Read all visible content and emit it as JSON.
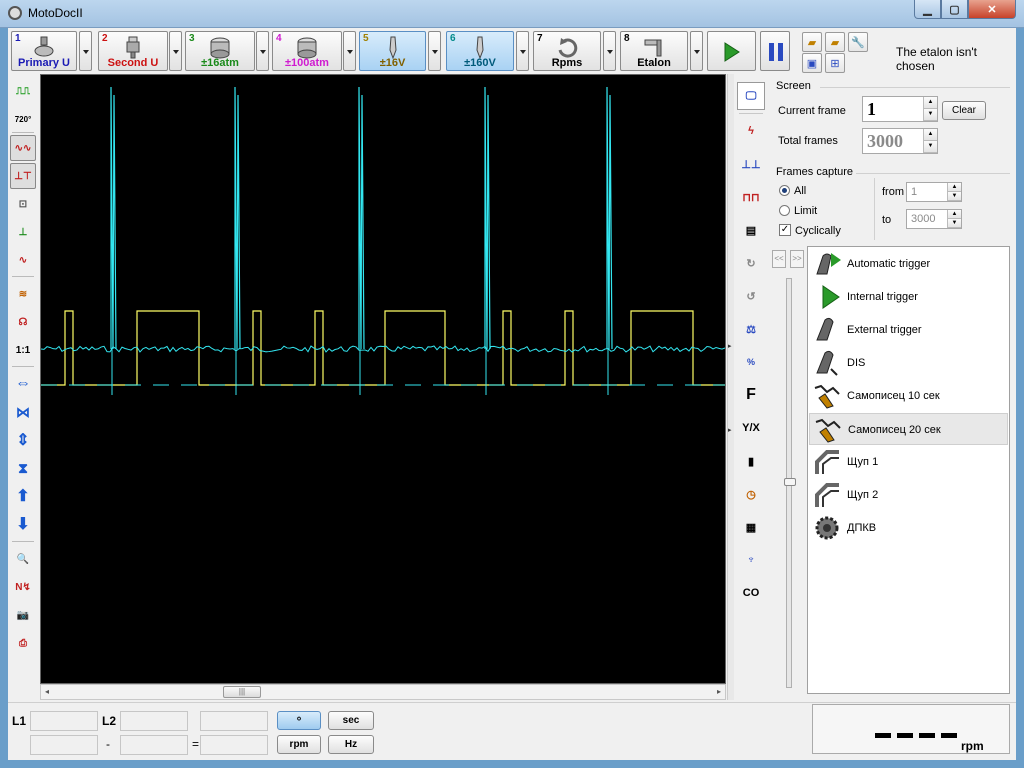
{
  "window": {
    "title": "MotoDocII"
  },
  "toolbar": {
    "channels": [
      {
        "num": "1",
        "label": "Primary U",
        "num_color": "#1a1ab4",
        "label_color": "#1a1ab4",
        "selected": false
      },
      {
        "num": "2",
        "label": "Second U",
        "num_color": "#cc1111",
        "label_color": "#cc1111",
        "selected": false
      },
      {
        "num": "3",
        "label": "±16atm",
        "num_color": "#1a8a1a",
        "label_color": "#1a8a1a",
        "selected": false
      },
      {
        "num": "4",
        "label": "±100atm",
        "num_color": "#d01ad0",
        "label_color": "#d01ad0",
        "selected": false
      },
      {
        "num": "5",
        "label": "±16V",
        "num_color": "#c8a000",
        "label_color": "#806000",
        "selected": true
      },
      {
        "num": "6",
        "label": "±160V",
        "num_color": "#008a8a",
        "label_color": "#005a7a",
        "selected": true
      },
      {
        "num": "7",
        "label": "Rpms",
        "num_color": "#222222",
        "label_color": "#222222",
        "selected": false
      },
      {
        "num": "8",
        "label": "Etalon",
        "num_color": "#222222",
        "label_color": "#222222",
        "selected": false
      }
    ],
    "status": "The etalon isn't chosen"
  },
  "screen": {
    "group_label": "Screen",
    "current_frame_label": "Current frame",
    "current_frame": "1",
    "clear_label": "Clear",
    "total_frames_label": "Total frames",
    "total_frames": "3000"
  },
  "capture": {
    "group_label": "Frames capture",
    "all_label": "All",
    "limit_label": "Limit",
    "cyclically_label": "Cyclically",
    "from_label": "from",
    "from_value": "1",
    "to_label": "to",
    "to_value": "3000"
  },
  "triggers": [
    {
      "label": "Automatic trigger",
      "icon": "automatic-trigger-icon"
    },
    {
      "label": "Internal trigger",
      "icon": "internal-trigger-icon"
    },
    {
      "label": "External trigger",
      "icon": "external-trigger-icon"
    },
    {
      "label": "DIS",
      "icon": "dis-icon"
    },
    {
      "label": "Самописец 10 сек",
      "icon": "recorder-10-icon"
    },
    {
      "label": "Самописец 20 сек",
      "icon": "recorder-20-icon",
      "selected": true
    },
    {
      "label": "Щуп 1",
      "icon": "probe-1-icon"
    },
    {
      "label": "Щуп 2",
      "icon": "probe-2-icon"
    },
    {
      "label": "ДПКВ",
      "icon": "crank-sensor-icon"
    }
  ],
  "left_toolbar": {
    "ratio_label": "1:1",
    "angle_label": "720°"
  },
  "right_icons": {
    "f_label": "F",
    "yx_label": "Y/X",
    "co_label": "CO",
    "percent_label": "%"
  },
  "bottom": {
    "l1_label": "L1",
    "l2_label": "L2",
    "dash_sep": "-",
    "equals_sep": "=",
    "degree_label": "°",
    "sec_label": "sec",
    "rpm_label": "rpm",
    "hz_label": "Hz",
    "rpm_unit": "rpm"
  },
  "colors": {
    "trace_yellow": "#ffff66",
    "trace_cyan": "#33e6f0",
    "scope_bg": "#000000"
  }
}
